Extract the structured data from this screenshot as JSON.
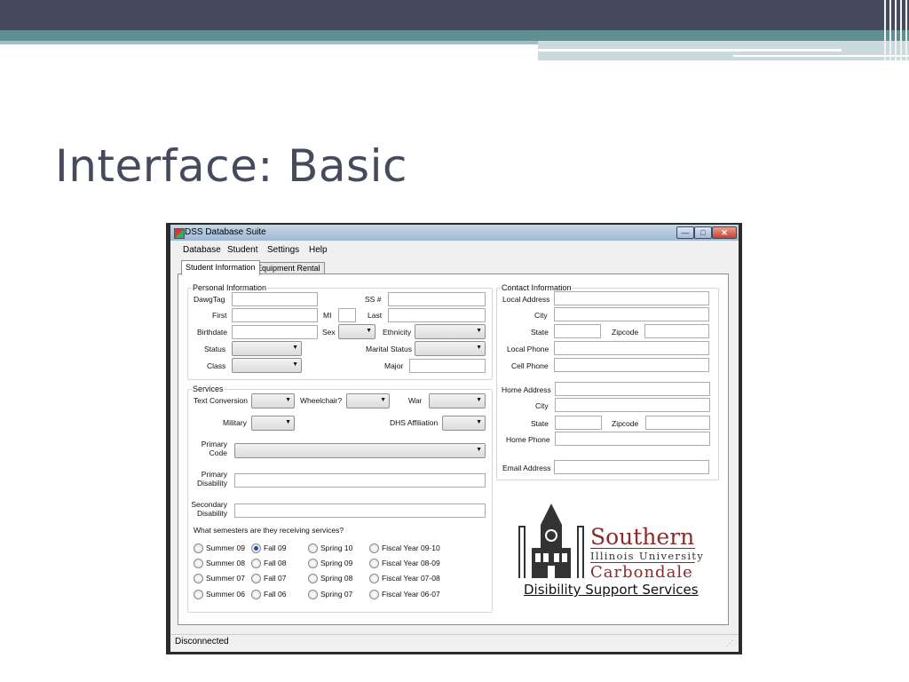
{
  "slide": {
    "title": "Interface: Basic"
  },
  "window": {
    "title": "DSS Database Suite",
    "controls": {
      "minimize": "—",
      "maximize": "□",
      "close": "✕"
    }
  },
  "menu": [
    "Database",
    "Student",
    "Settings",
    "Help"
  ],
  "tabs": [
    "Student Information",
    "Equipment Rental"
  ],
  "personal": {
    "legend": "Personal Information",
    "dawgtag": "DawgTag",
    "ssn": "SS #",
    "first": "First",
    "mi": "MI",
    "last": "Last",
    "birthdate": "Birthdate",
    "sex": "Sex",
    "ethnicity": "Ethnicity",
    "status": "Status",
    "marital": "Marital Status",
    "class": "Class",
    "major": "Major"
  },
  "contact": {
    "legend": "Contact Information",
    "local_address": "Local Address",
    "city": "City",
    "state": "State",
    "zipcode": "Zipcode",
    "local_phone": "Local Phone",
    "cell_phone": "Cell Phone",
    "home_address": "Home Address",
    "home_city": "City",
    "home_state": "State",
    "home_zipcode": "Zipcode",
    "home_phone": "Home Phone",
    "email": "Email Address"
  },
  "services": {
    "legend": "Services",
    "text_conversion": "Text Conversion",
    "wheelchair": "Wheelchair?",
    "war": "War",
    "military": "Military",
    "dhs": "DHS Affiliation",
    "primary_code_1": "Primary",
    "primary_code_2": "Code",
    "primary_dis_1": "Primary",
    "primary_dis_2": "Disability",
    "secondary_dis_1": "Secondary",
    "secondary_dis_2": "Disability",
    "semesters_q": "What semesters are they receiving services?",
    "semesters": [
      [
        "Summer 09",
        "Fall 09",
        "Spring 10",
        "Fiscal Year 09-10"
      ],
      [
        "Summer 08",
        "Fall 08",
        "Spring 09",
        "Fiscal Year 08-09"
      ],
      [
        "Summer 07",
        "Fall 07",
        "Spring 08",
        "Fiscal Year 07-08"
      ],
      [
        "Summer 06",
        "Fall 06",
        "Spring 07",
        "Fiscal Year 06-07"
      ]
    ],
    "selected_semester": "Fall 09"
  },
  "logo": {
    "southern": "Southern",
    "illinois": "Illinois University",
    "carbondale": "Carbondale",
    "dss": "Disibility Support Services"
  },
  "status_bar": {
    "text": "Disconnected"
  },
  "icons": {
    "combo_arrow": "▼",
    "size_grip": "⋰"
  },
  "colors": {
    "header_dark": "#454a5c",
    "header_teal": "#5f8f92",
    "brand_maroon": "#8e2a2a",
    "radio_selected": "#1f4ea3"
  }
}
